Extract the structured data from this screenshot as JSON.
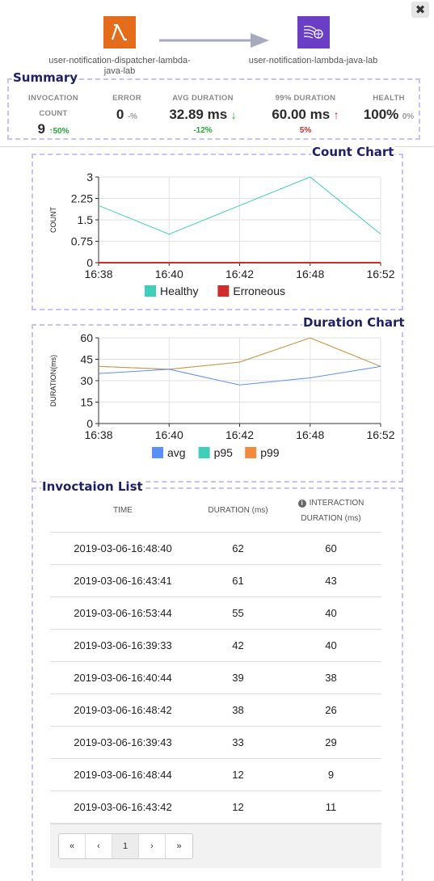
{
  "close_glyph": "✖",
  "flow": {
    "source": {
      "name": "user-notification-dispatcher-lambda-java-lab",
      "icon": "lambda-icon"
    },
    "target": {
      "name": "user-notification-lambda-java-lab",
      "icon": "eventbridge-icon"
    }
  },
  "summary": {
    "title": "Summary",
    "invocation_label_1": "INVOCATION",
    "invocation_label_2": "COUNT",
    "invocation_value": "9",
    "invocation_change": "↑50%",
    "error_label": "ERROR",
    "error_value": "0",
    "error_change": "-%",
    "avg_label": "AVG DURATION",
    "avg_value": "32.89 ms",
    "avg_arrow": "↓",
    "avg_change": "-12%",
    "p99_label": "99% DURATION",
    "p99_value": "60.00 ms",
    "p99_arrow": "↑",
    "p99_change": "5%",
    "health_label": "HEALTH",
    "health_value": "100%",
    "health_change": "0%"
  },
  "count_chart": {
    "title": "Count Chart",
    "chart_data": {
      "type": "line",
      "x": [
        "16:38",
        "16:40",
        "16:42",
        "16:48",
        "16:52"
      ],
      "ylabel": "COUNT",
      "ylim": [
        0,
        3
      ],
      "yticks": [
        "0",
        "0.75",
        "1.5",
        "2.25",
        "3"
      ],
      "series": [
        {
          "name": "Healthy",
          "color": "#3fcfb9",
          "values": [
            2,
            1,
            2,
            3,
            1
          ]
        },
        {
          "name": "Erroneous",
          "color": "#d12b2b",
          "values": [
            0,
            0,
            0,
            0,
            0
          ]
        }
      ]
    }
  },
  "duration_chart": {
    "title": "Duration Chart",
    "chart_data": {
      "type": "line",
      "x": [
        "16:38",
        "16:40",
        "16:42",
        "16:48",
        "16:52"
      ],
      "ylabel": "DURATION(ms)",
      "ylim": [
        0,
        60
      ],
      "yticks": [
        "0",
        "15",
        "30",
        "45",
        "60"
      ],
      "series": [
        {
          "name": "avg",
          "color": "#5b8ff9",
          "values": [
            35,
            38,
            27,
            32,
            40
          ]
        },
        {
          "name": "p95",
          "color": "#3fcfb9",
          "values": [
            40,
            38,
            43,
            60,
            40
          ]
        },
        {
          "name": "p99",
          "color": "#f38b3a",
          "values": [
            40,
            38,
            43,
            60,
            40
          ]
        }
      ]
    }
  },
  "invocation_list": {
    "title": "Invoctaion List",
    "columns": [
      "TIME",
      "DURATION (ms)",
      "INTERACTION",
      "DURATION (ms)"
    ],
    "info_glyph": "i",
    "rows": [
      [
        "2019-03-06-16:48:40",
        "62",
        "60"
      ],
      [
        "2019-03-06-16:43:41",
        "61",
        "43"
      ],
      [
        "2019-03-06-16:53:44",
        "55",
        "40"
      ],
      [
        "2019-03-06-16:39:33",
        "42",
        "40"
      ],
      [
        "2019-03-06-16:40:44",
        "39",
        "38"
      ],
      [
        "2019-03-06-16:48:42",
        "38",
        "26"
      ],
      [
        "2019-03-06-16:39:43",
        "33",
        "29"
      ],
      [
        "2019-03-06-16:48:44",
        "12",
        "9"
      ],
      [
        "2019-03-06-16:43:42",
        "12",
        "11"
      ]
    ]
  },
  "pagination": {
    "first": "«",
    "prev": "‹",
    "page": "1",
    "next": "›",
    "last": "»"
  }
}
